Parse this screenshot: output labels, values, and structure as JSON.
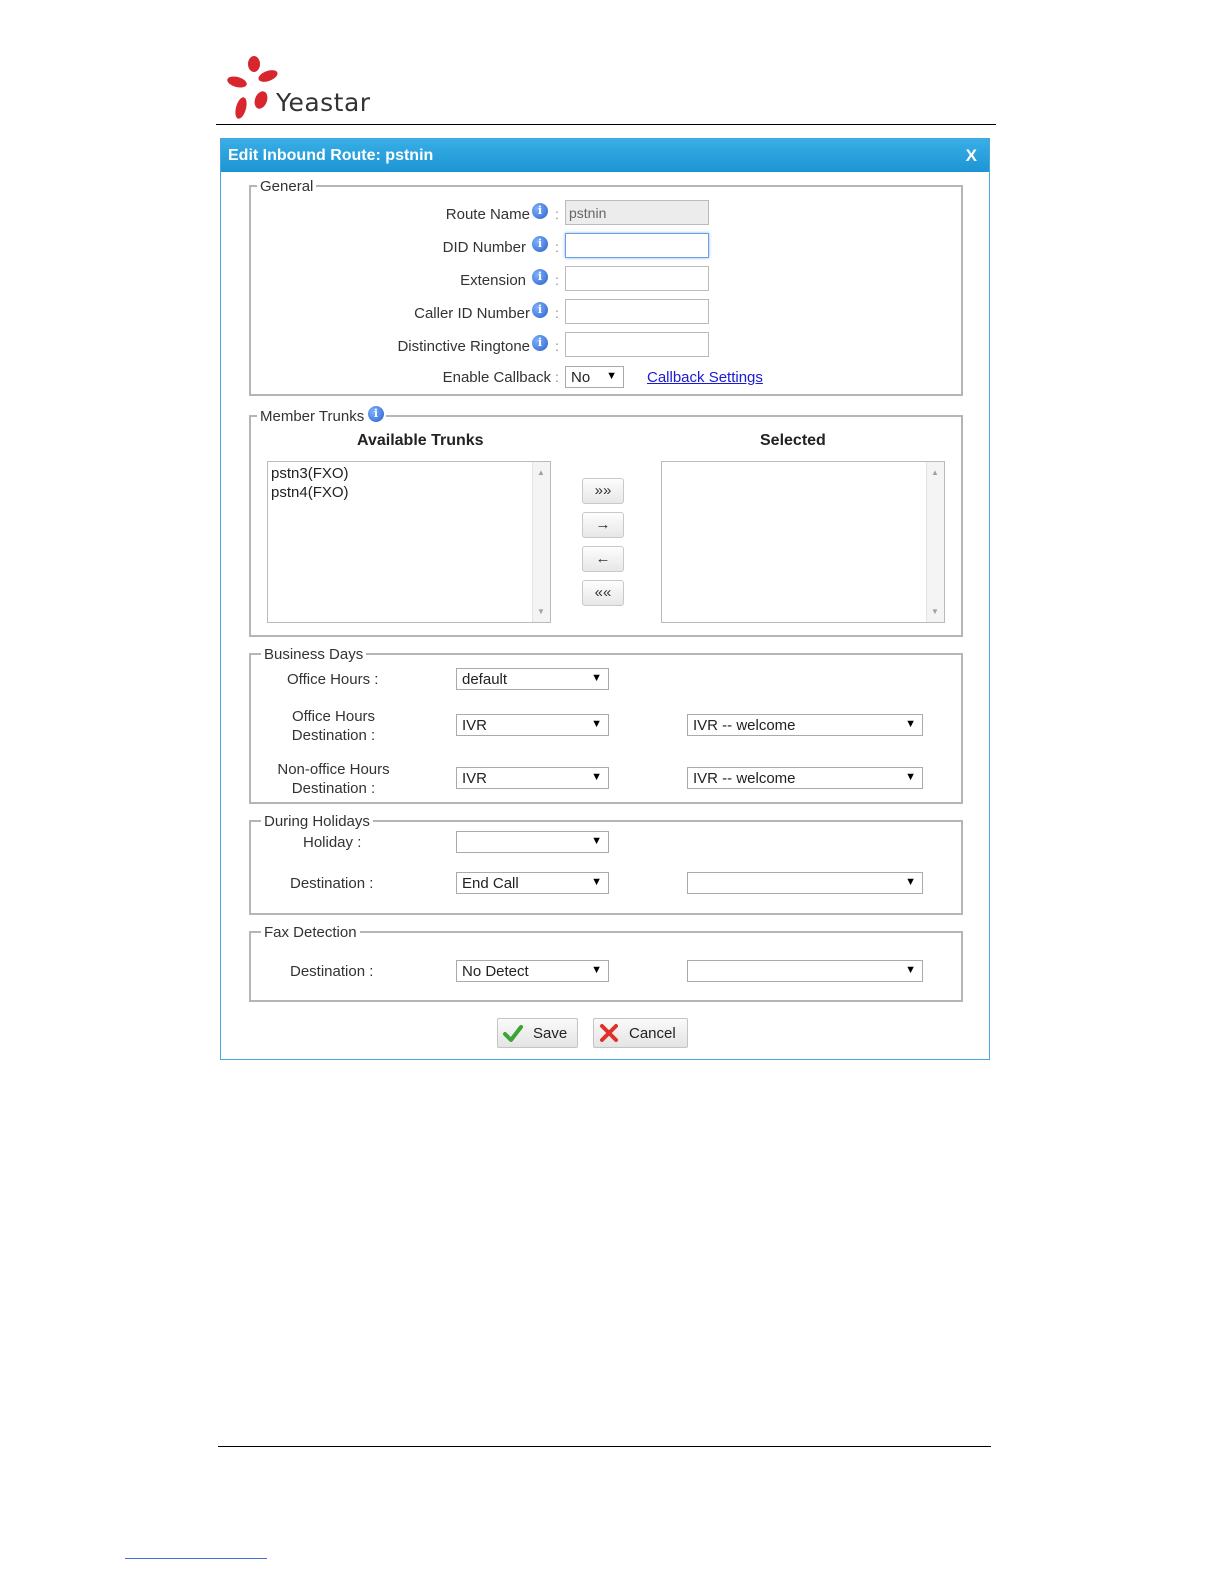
{
  "brand": {
    "name": "Yeastar"
  },
  "dialog": {
    "title": "Edit Inbound Route: pstnin",
    "close": "X"
  },
  "general": {
    "legend": "General",
    "route_name_label": "Route Name",
    "route_name_value": "pstnin",
    "did_number_label": "DID Number",
    "did_number_value": "",
    "extension_label": "Extension",
    "extension_value": "",
    "caller_id_label": "Caller ID Number",
    "caller_id_value": "",
    "ringtone_label": "Distinctive Ringtone",
    "ringtone_value": "",
    "callback_label": "Enable Callback",
    "callback_value": "No",
    "callback_settings_link": "Callback Settings",
    "colon": ":"
  },
  "trunks": {
    "legend": "Member Trunks",
    "available_header": "Available Trunks",
    "selected_header": "Selected",
    "available": [
      "pstn3(FXO)",
      "pstn4(FXO)"
    ],
    "buttons": {
      "add_all": "»»",
      "add": "→",
      "remove": "←",
      "remove_all": "««"
    }
  },
  "business_days": {
    "legend": "Business Days",
    "office_hours_label": "Office Hours :",
    "office_hours_value": "default",
    "office_dest_label_1": "Office Hours",
    "office_dest_label_2": "Destination :",
    "office_dest_value": "IVR",
    "office_dest_target": "IVR -- welcome",
    "nonoffice_dest_label_1": "Non-office Hours",
    "nonoffice_dest_label_2": "Destination :",
    "nonoffice_dest_value": "IVR",
    "nonoffice_dest_target": "IVR -- welcome"
  },
  "holidays": {
    "legend": "During Holidays",
    "holiday_label": "Holiday :",
    "holiday_value": "",
    "dest_label": "Destination :",
    "dest_value": "End Call",
    "dest_target": ""
  },
  "fax": {
    "legend": "Fax Detection",
    "dest_label": "Destination :",
    "dest_value": "No Detect",
    "dest_target": ""
  },
  "actions": {
    "save": "Save",
    "cancel": "Cancel"
  },
  "colors": {
    "titlebar": "#1d95d4",
    "link": "#1a1ad4",
    "brand_red": "#d8262e"
  }
}
